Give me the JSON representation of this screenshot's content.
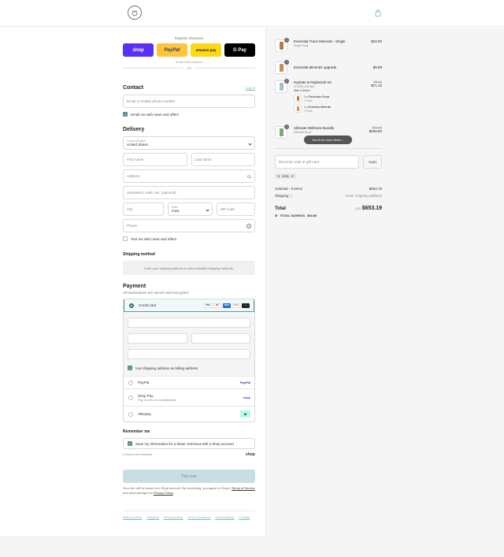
{
  "colors": {
    "accent": "#5b8f94",
    "link": "#7ab8bf",
    "shop": "#5a31f4",
    "paypal": "#ffc439",
    "amazon": "#ffd814"
  },
  "express": {
    "title": "Express checkout",
    "buttons": {
      "shop": "shop",
      "paypal": "PayPal",
      "amazon": "amazon pay",
      "gpay": "G Pay"
    },
    "show_more": "Show more options",
    "or": "OR"
  },
  "contact": {
    "heading": "Contact",
    "login": "Log in",
    "email_placeholder": "Email or mobile phone number",
    "email_news": "Email me with news and offers"
  },
  "delivery": {
    "heading": "Delivery",
    "country_label": "Country/Region",
    "country_value": "United States",
    "first_name": "First name",
    "last_name": "Last name",
    "address": "Address",
    "apartment": "Apartment, suite, etc. (optional)",
    "city": "City",
    "state_label": "State",
    "state_value": "Iowa",
    "zip": "ZIP code",
    "phone": "Phone",
    "text_news": "Text me with news and offers"
  },
  "shipping_method": {
    "heading": "Shipping method",
    "placeholder": "Enter your shipping address to view available shipping methods."
  },
  "payment": {
    "heading": "Payment",
    "subtitle": "All transactions are secure and encrypted.",
    "credit_card": "Credit card",
    "card_brands": [
      "VISA",
      "MC",
      "AMEX",
      "DISC",
      "+"
    ],
    "use_shipping": "Use shipping address as billing address",
    "paypal": "PayPal",
    "paypal_tag": "PayPal",
    "shop_pay": "Shop Pay",
    "shop_pay_sub": "Pay in full or in installments",
    "shop_pay_tag": "shop",
    "afterpay": "Afterpay"
  },
  "remember": {
    "heading": "Remember me",
    "save_info": "Save my information for a faster checkout with a Shop account",
    "secure": "Secure and encrypted",
    "shop_tag": "shop"
  },
  "pay_now": "Pay now",
  "fine_print": {
    "text": "Your info will be saved to a Shop account. By continuing, you agree to Shop's",
    "terms": "Terms of Service",
    "and": "and acknowledge the",
    "privacy": "Privacy Policy",
    "end": "."
  },
  "policies": [
    "Refund policy",
    "Shipping",
    "Privacy policy",
    "Terms of service",
    "Cancellations",
    "Contact"
  ],
  "cart": {
    "items": [
      {
        "qty": "1",
        "name": "Essential Trace Minerals - Single",
        "sub": "Single Pack",
        "price": "$24.00",
        "old": ""
      },
      {
        "qty": "1",
        "name": "Essential Minerals upgrade",
        "sub": "",
        "price": "$9.99",
        "old": ""
      },
      {
        "qty": "1",
        "name": "Hydrate & Replenish Kit",
        "sub": "DEB (-$13.60)",
        "price": "$71.10",
        "old": "$84.70"
      },
      {
        "qty": "1",
        "name": "Ultimate Wellness Bundle",
        "sub": "Ultimate Bund...",
        "price": "$269.80",
        "old": "$324.60"
      }
    ],
    "hide_items": "Hide 4 items",
    "sub_items": [
      {
        "name": "1 x Electrolyte Drops",
        "sub": "2 Pack"
      },
      {
        "name": "1 x Essential Minerals",
        "sub": "2 Pack"
      }
    ],
    "tooltip": "Scroll for more items",
    "discount_placeholder": "Discount code or gift card",
    "apply": "Apply",
    "code_chip": "DEB",
    "subtotal_label": "Subtotal · 5 items",
    "subtotal_value": "$653.19",
    "shipping_label": "Shipping",
    "shipping_value": "Enter shipping address",
    "total_label": "Total",
    "currency": "USD",
    "total_value": "$653.19",
    "savings_label": "TOTAL SAVINGS",
    "savings_value": "$68.80"
  }
}
